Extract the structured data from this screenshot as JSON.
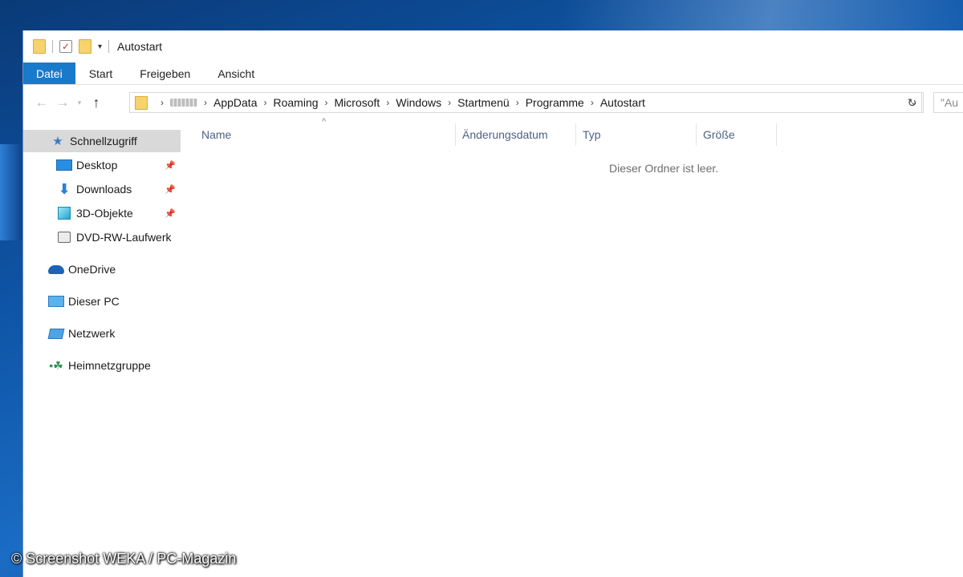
{
  "window": {
    "title": "Autostart"
  },
  "ribbon": {
    "tabs": [
      {
        "label": "Datei"
      },
      {
        "label": "Start"
      },
      {
        "label": "Freigeben"
      },
      {
        "label": "Ansicht"
      }
    ]
  },
  "nav": {
    "back_icon": "arrow-left-icon",
    "forward_icon": "arrow-right-icon",
    "recent_icon": "chevron-down-icon",
    "up_icon": "arrow-up-icon"
  },
  "address": {
    "crumbs": [
      "AppData",
      "Roaming",
      "Microsoft",
      "Windows",
      "Startmenü",
      "Programme",
      "Autostart"
    ]
  },
  "search": {
    "placeholder": "\"Au"
  },
  "sidebar": {
    "items": [
      {
        "label": "Schnellzugriff",
        "icon": "star-icon"
      },
      {
        "label": "Desktop",
        "icon": "desktop-icon",
        "pinned": true
      },
      {
        "label": "Downloads",
        "icon": "download-icon",
        "pinned": true
      },
      {
        "label": "3D-Objekte",
        "icon": "cube-icon",
        "pinned": true
      },
      {
        "label": "DVD-RW-Laufwerk",
        "icon": "dvd-drive-icon"
      },
      {
        "label": "OneDrive",
        "icon": "cloud-icon"
      },
      {
        "label": "Dieser PC",
        "icon": "computer-icon"
      },
      {
        "label": "Netzwerk",
        "icon": "network-icon"
      },
      {
        "label": "Heimnetzgruppe",
        "icon": "homegroup-icon"
      }
    ]
  },
  "columns": [
    "Name",
    "Änderungsdatum",
    "Typ",
    "Größe"
  ],
  "content": {
    "empty_message": "Dieser Ordner ist leer."
  },
  "watermark": {
    "text": "© Screenshot WEKA / PC-Magazin"
  }
}
